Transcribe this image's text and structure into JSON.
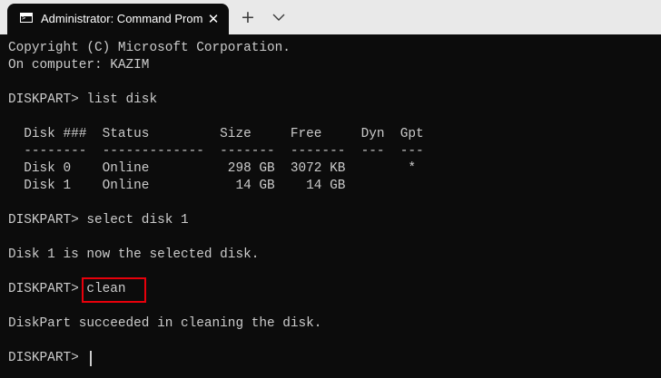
{
  "titlebar": {
    "tab_title": "Administrator: Command Prompt",
    "close_glyph": "✕",
    "new_tab_glyph": "+"
  },
  "icons": {
    "tab_icon": "command-prompt-icon",
    "close": "close-icon",
    "new_tab": "plus-icon",
    "dropdown": "chevron-down-icon"
  },
  "terminal": {
    "lines": [
      "Copyright (C) Microsoft Corporation.",
      "On computer: KAZIM",
      "",
      "DISKPART> list disk",
      "",
      "  Disk ###  Status         Size     Free     Dyn  Gpt",
      "  --------  -------------  -------  -------  ---  ---",
      "  Disk 0    Online          298 GB  3072 KB        *",
      "  Disk 1    Online           14 GB    14 GB",
      "",
      "DISKPART> select disk 1",
      "",
      "Disk 1 is now the selected disk.",
      "",
      "DISKPART> clean",
      "",
      "DiskPart succeeded in cleaning the disk.",
      "",
      "DISKPART> "
    ]
  },
  "colors": {
    "terminal_bg": "#0c0c0c",
    "terminal_text": "#cccccc",
    "titlebar_bg": "#e9e9e9",
    "highlight_border": "#e8000b"
  }
}
